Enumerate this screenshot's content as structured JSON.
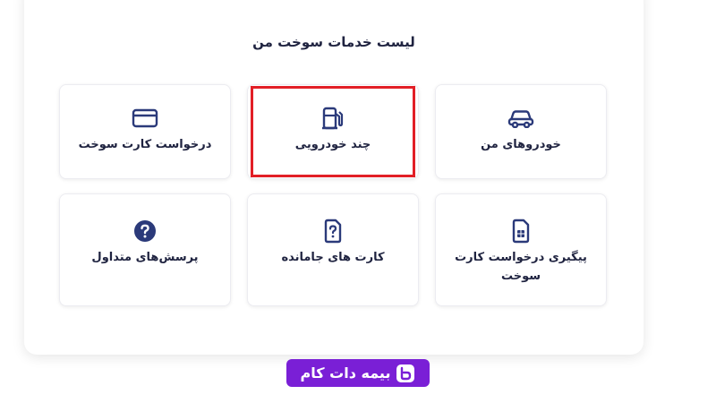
{
  "panel": {
    "title": "لیست خدمات سوخت من"
  },
  "tiles": [
    {
      "label": "خودروهای من",
      "icon": "car-icon"
    },
    {
      "label": "چند خودرویی",
      "icon": "fuel-pump-icon"
    },
    {
      "label": "درخواست کارت سوخت",
      "icon": "credit-card-icon"
    },
    {
      "label": "پیگیری درخواست کارت سوخت",
      "icon": "sim-card-icon"
    },
    {
      "label": "کارت های جامانده",
      "icon": "card-question-icon"
    },
    {
      "label": "پرسش‌های متداول",
      "icon": "help-circle-icon"
    }
  ],
  "watermark": {
    "text": "بیمه دات کام",
    "icon": "brand-logo-icon"
  },
  "colors": {
    "icon": "#2b3a7a",
    "text": "#1f2340",
    "highlight": "#e21f26",
    "brand": "#7a1fd6"
  }
}
